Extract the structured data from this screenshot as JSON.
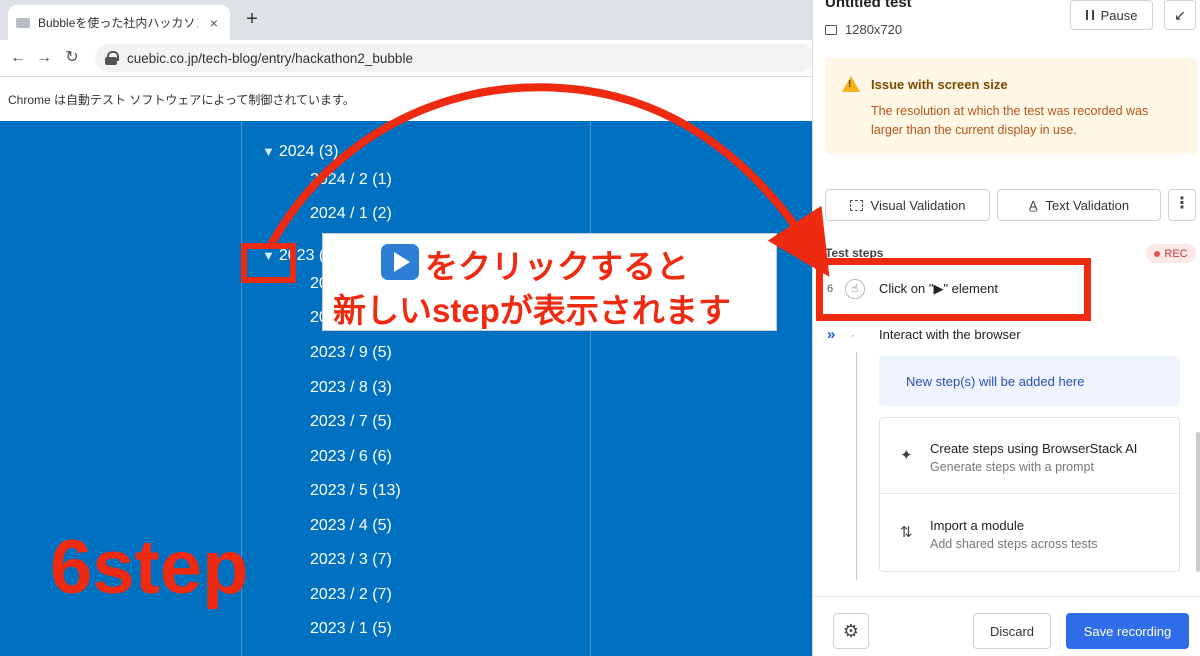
{
  "browser": {
    "tab_title": "Bubbleを使った社内ハッカソンを開催",
    "tab_close": "×",
    "new_tab": "+",
    "nav_back": "←",
    "nav_forward": "→",
    "nav_reload": "↻",
    "url": "cuebic.co.jp/tech-blog/entry/hackathon2_bubble",
    "infobar": "Chrome は自動テスト ソフトウェアによって制御されています。"
  },
  "archive": {
    "items": [
      {
        "label": "2024 (3)",
        "type": "year"
      },
      {
        "label": "2024 / 2 (1)",
        "type": "month"
      },
      {
        "label": "2024 / 1 (2)",
        "type": "month"
      },
      {
        "label": "2023 (",
        "type": "year"
      },
      {
        "label": "20",
        "type": "month"
      },
      {
        "label": "2023 / 10 (5)",
        "type": "month"
      },
      {
        "label": "2023 / 9 (5)",
        "type": "month"
      },
      {
        "label": "2023 / 8 (3)",
        "type": "month"
      },
      {
        "label": "2023 / 7 (5)",
        "type": "month"
      },
      {
        "label": "2023 / 6 (6)",
        "type": "month"
      },
      {
        "label": "2023 / 5 (13)",
        "type": "month"
      },
      {
        "label": "2023 / 4 (5)",
        "type": "month"
      },
      {
        "label": "2023 / 3 (7)",
        "type": "month"
      },
      {
        "label": "2023 / 2 (7)",
        "type": "month"
      },
      {
        "label": "2023 / 1 (5)",
        "type": "month"
      }
    ],
    "triangle": "▼"
  },
  "annotation": {
    "callout_line1": "をクリックすると",
    "callout_line2": "新しいstepが表示されます",
    "step_count": "6step",
    "color": "#ee2a10"
  },
  "panel": {
    "title": "Untitled test",
    "resolution": "1280x720",
    "pause_label": "Pause",
    "minimize_icon": "↙",
    "warning": {
      "title": "Issue with screen size",
      "body": "The resolution at which the test was recorded was larger than the current display in use."
    },
    "visual_validation": "Visual Validation",
    "text_validation": "Text Validation",
    "more_icon": "⋮",
    "test_steps_label": "Test steps",
    "rec_label": "REC",
    "step": {
      "number": "6",
      "label": "Click on \"▶\" element"
    },
    "interact_label": "Interact with the browser",
    "new_steps_text": "New step(s) will be added here",
    "option_ai": {
      "title": "Create steps using BrowserStack AI",
      "desc": "Generate steps with a prompt"
    },
    "option_module": {
      "title": "Import a module",
      "desc": "Add shared steps across tests"
    },
    "discard_label": "Discard",
    "save_label": "Save recording",
    "accent_color": "#2f6ee8"
  }
}
